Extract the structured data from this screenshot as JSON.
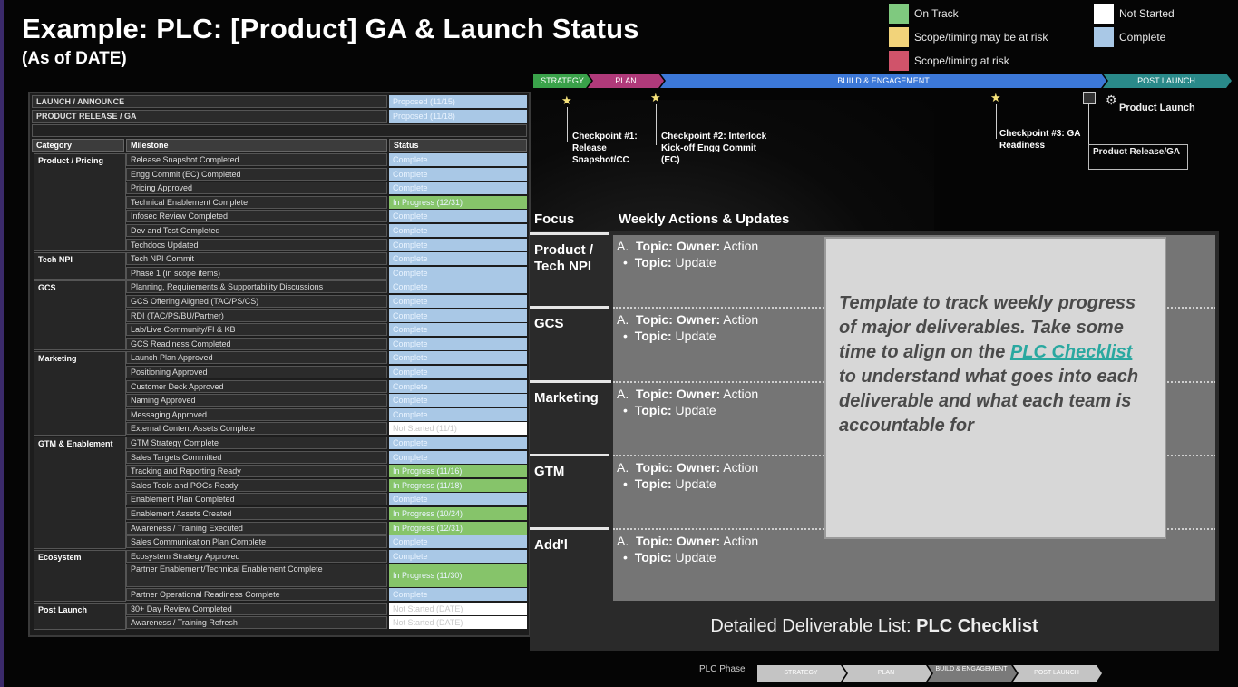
{
  "title": "Example: PLC: [Product] GA & Launch Status",
  "subtitle": "(As of DATE)",
  "legend": [
    {
      "label": "On Track",
      "color": "#7fc97f"
    },
    {
      "label": "Scope/timing may be at risk",
      "color": "#f2d37a"
    },
    {
      "label": "Scope/timing at risk",
      "color": "#d0536a"
    },
    {
      "label": "Not Started",
      "color": "#ffffff"
    },
    {
      "label": "Complete",
      "color": "#a9c8e6"
    }
  ],
  "table": {
    "launch_label": "LAUNCH / ANNOUNCE",
    "launch_status": "Proposed (11/15)",
    "release_label": "PRODUCT RELEASE / GA",
    "release_status": "Proposed (11/18)",
    "col_category": "Category",
    "col_milestone": "Milestone",
    "col_status": "Status",
    "categories": [
      "Product / Pricing",
      "Tech NPI",
      "GCS",
      "Marketing",
      "GTM & Enablement",
      "Ecosystem",
      "Post Launch"
    ],
    "rows": [
      {
        "milestone": "Release Snapshot Completed",
        "status": "Complete"
      },
      {
        "milestone": "Engg Commit (EC) Completed",
        "status": "Complete"
      },
      {
        "milestone": "Pricing Approved",
        "status": "Complete"
      },
      {
        "milestone": "Technical Enablement Complete",
        "status": "In Progress (12/31)"
      },
      {
        "milestone": "Infosec Review Completed",
        "status": "Complete"
      },
      {
        "milestone": "Dev and Test Completed",
        "status": "Complete"
      },
      {
        "milestone": "Techdocs Updated",
        "status": "Complete"
      },
      {
        "milestone": "Tech NPI Commit",
        "status": "Complete"
      },
      {
        "milestone": "Phase 1 (in scope items)",
        "status": "Complete"
      },
      {
        "milestone": "Planning, Requirements & Supportability Discussions",
        "status": "Complete"
      },
      {
        "milestone": "GCS Offering Aligned (TAC/PS/CS)",
        "status": "Complete"
      },
      {
        "milestone": "RDI (TAC/PS/BU/Partner)",
        "status": "Complete"
      },
      {
        "milestone": "Lab/Live Community/FI & KB",
        "status": "Complete"
      },
      {
        "milestone": "GCS Readiness Completed",
        "status": "Complete"
      },
      {
        "milestone": "Launch Plan Approved",
        "status": "Complete"
      },
      {
        "milestone": "Positioning Approved",
        "status": "Complete"
      },
      {
        "milestone": "Customer Deck Approved",
        "status": "Complete"
      },
      {
        "milestone": "Naming Approved",
        "status": "Complete"
      },
      {
        "milestone": "Messaging Approved",
        "status": "Complete"
      },
      {
        "milestone": "External Content Assets Complete",
        "status": "Not Started (11/1)"
      },
      {
        "milestone": "GTM Strategy Complete",
        "status": "Complete"
      },
      {
        "milestone": "Sales Targets Committed",
        "status": "Complete"
      },
      {
        "milestone": "Tracking and Reporting Ready",
        "status": "In Progress (11/16)"
      },
      {
        "milestone": "Sales Tools and POCs Ready",
        "status": "In Progress (11/18)"
      },
      {
        "milestone": "Enablement Plan Completed",
        "status": "Complete"
      },
      {
        "milestone": "Enablement Assets Created",
        "status": "In Progress (10/24)"
      },
      {
        "milestone": "Awareness / Training Executed",
        "status": "In Progress (12/31)"
      },
      {
        "milestone": "Sales Communication Plan Complete",
        "status": "Complete"
      },
      {
        "milestone": "Ecosystem Strategy Approved",
        "status": "Complete"
      },
      {
        "milestone": "Partner Enablement/Technical Enablement Complete",
        "status": "In Progress (11/30)"
      },
      {
        "milestone": "Partner Operational Readiness Complete",
        "status": "Complete"
      },
      {
        "milestone": "30+ Day Review Completed",
        "status": "Not Started (DATE)"
      },
      {
        "milestone": "Awareness / Training Refresh",
        "status": "Not Started (DATE)"
      }
    ]
  },
  "timeline": {
    "phases": [
      "STRATEGY",
      "PLAN",
      "BUILD & ENGAGEMENT",
      "POST LAUNCH"
    ],
    "checkpoint1": "Checkpoint #1: Release Snapshot/CC",
    "checkpoint2": "Checkpoint #2: Interlock Kick-off Engg Commit (EC)",
    "checkpoint3": "Checkpoint #3: GA Readiness",
    "product_launch": "Product Launch",
    "product_release": "Product Release/GA"
  },
  "focus": {
    "col_focus": "Focus",
    "col_weekly": "Weekly Actions & Updates",
    "rows": [
      {
        "name": "Product / Tech NPI"
      },
      {
        "name": "GCS"
      },
      {
        "name": "Marketing"
      },
      {
        "name": "GTM"
      },
      {
        "name": "Add'l"
      }
    ],
    "item_a_topic": "Topic:",
    "item_a_owner": "Owner:",
    "item_a_action": "Action",
    "item_b_topic": "Topic:",
    "item_b_update": "Update",
    "note_pre": "Template to track weekly progress of major deliverables. Take some time to align on the ",
    "note_link": "PLC Checklist",
    "note_post": " to understand what goes into each deliverable and what each team is accountable for",
    "detail_prefix": "Detailed Deliverable List: ",
    "detail_link": "PLC Checklist"
  },
  "bottom": {
    "label": "PLC Phase",
    "phases": [
      "STRATEGY",
      "PLAN",
      "BUILD & ENGAGEMENT",
      "POST LAUNCH"
    ]
  }
}
